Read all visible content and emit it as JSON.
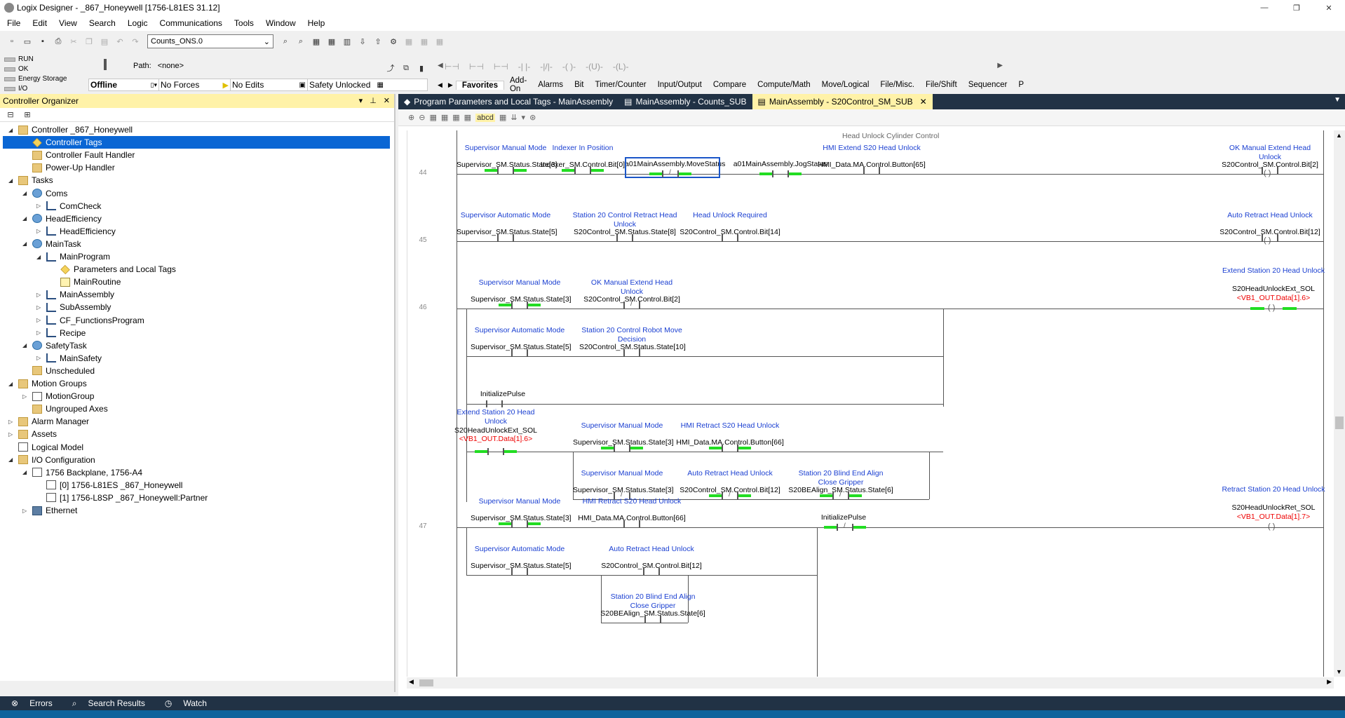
{
  "window": {
    "title": "Logix Designer - _867_Honeywell [1756-L81ES 31.12]"
  },
  "menu": [
    "File",
    "Edit",
    "View",
    "Search",
    "Logic",
    "Communications",
    "Tools",
    "Window",
    "Help"
  ],
  "toolbar": {
    "combo_value": "Counts_ONS.0"
  },
  "status": {
    "leds": [
      "RUN",
      "OK",
      "Energy Storage",
      "I/O"
    ],
    "path_label": "Path:",
    "path_value": "<none>",
    "mode": "Offline",
    "forces": "No Forces",
    "edits": "No Edits",
    "safety": "Safety Unlocked"
  },
  "instruction_tabs": [
    "Favorites",
    "Add-On",
    "Alarms",
    "Bit",
    "Timer/Counter",
    "Input/Output",
    "Compare",
    "Compute/Math",
    "Move/Logical",
    "File/Misc.",
    "File/Shift",
    "Sequencer",
    "P"
  ],
  "organizer": {
    "title": "Controller Organizer",
    "tree": [
      {
        "label": "Controller _867_Honeywell",
        "level": 0,
        "icon": "folder",
        "exp": "▲"
      },
      {
        "label": "Controller Tags",
        "level": 1,
        "icon": "tag",
        "exp": "",
        "selected": true
      },
      {
        "label": "Controller Fault Handler",
        "level": 1,
        "icon": "folder",
        "exp": ""
      },
      {
        "label": "Power-Up Handler",
        "level": 1,
        "icon": "folder",
        "exp": ""
      },
      {
        "label": "Tasks",
        "level": 0,
        "icon": "folder",
        "exp": "▲"
      },
      {
        "label": "Coms",
        "level": 1,
        "icon": "clock",
        "exp": "▲"
      },
      {
        "label": "ComCheck",
        "level": 2,
        "icon": "program",
        "exp": "▶"
      },
      {
        "label": "HeadEfficiency",
        "level": 1,
        "icon": "clock",
        "exp": "▲"
      },
      {
        "label": "HeadEfficiency",
        "level": 2,
        "icon": "program",
        "exp": "▶"
      },
      {
        "label": "MainTask",
        "level": 1,
        "icon": "clock",
        "exp": "▲"
      },
      {
        "label": "MainProgram",
        "level": 2,
        "icon": "program",
        "exp": "▲"
      },
      {
        "label": "Parameters and Local Tags",
        "level": 3,
        "icon": "tag",
        "exp": ""
      },
      {
        "label": "MainRoutine",
        "level": 3,
        "icon": "routine",
        "exp": ""
      },
      {
        "label": "MainAssembly",
        "level": 2,
        "icon": "program",
        "exp": "▶"
      },
      {
        "label": "SubAssembly",
        "level": 2,
        "icon": "program",
        "exp": "▶"
      },
      {
        "label": "CF_FunctionsProgram",
        "level": 2,
        "icon": "program",
        "exp": "▶"
      },
      {
        "label": "Recipe",
        "level": 2,
        "icon": "program",
        "exp": "▶"
      },
      {
        "label": "SafetyTask",
        "level": 1,
        "icon": "clock",
        "exp": "▲"
      },
      {
        "label": "MainSafety",
        "level": 2,
        "icon": "program",
        "exp": "▶"
      },
      {
        "label": "Unscheduled",
        "level": 1,
        "icon": "folder",
        "exp": ""
      },
      {
        "label": "Motion Groups",
        "level": 0,
        "icon": "folder",
        "exp": "▲"
      },
      {
        "label": "MotionGroup",
        "level": 1,
        "icon": "module",
        "exp": "▶"
      },
      {
        "label": "Ungrouped Axes",
        "level": 1,
        "icon": "folder",
        "exp": ""
      },
      {
        "label": "Alarm Manager",
        "level": 0,
        "icon": "folder",
        "exp": "▶"
      },
      {
        "label": "Assets",
        "level": 0,
        "icon": "folder",
        "exp": "▶"
      },
      {
        "label": "Logical Model",
        "level": 0,
        "icon": "module",
        "exp": ""
      },
      {
        "label": "I/O Configuration",
        "level": 0,
        "icon": "folder",
        "exp": "▲"
      },
      {
        "label": "1756 Backplane, 1756-A4",
        "level": 1,
        "icon": "module",
        "exp": "▲"
      },
      {
        "label": "[0] 1756-L81ES _867_Honeywell",
        "level": 2,
        "icon": "module",
        "exp": ""
      },
      {
        "label": "[1] 1756-L8SP _867_Honeywell:Partner",
        "level": 2,
        "icon": "module",
        "exp": ""
      },
      {
        "label": "Ethernet",
        "level": 1,
        "icon": "network",
        "exp": "▶"
      }
    ]
  },
  "doc_tabs": [
    {
      "label": "Program Parameters and Local Tags - MainAssembly",
      "active": false
    },
    {
      "label": "MainAssembly - Counts_SUB",
      "active": false
    },
    {
      "label": "MainAssembly - S20Control_SM_SUB",
      "active": true
    }
  ],
  "bottom_tabs": [
    "Errors",
    "Search Results",
    "Watch"
  ],
  "ladder": {
    "rung_comment": "Head Unlock Cylinder Control",
    "rung_numbers": [
      "44",
      "45",
      "46",
      "47"
    ],
    "r44": {
      "d1": "Supervisor Manual Mode",
      "t1": "Supervisor_SM.Status.State[3]",
      "d2": "Indexer In Position",
      "t2": "Indexer_SM.Control.Bit[0]",
      "t3": "a01MainAssembly.MoveStatus",
      "t4": "a01MainAssembly.JogStatus",
      "d5": "HMI Extend S20 Head Unlock",
      "t5": "HMI_Data.MA.Control.Button[65]",
      "dc": "OK Manual Extend Head Unlock",
      "tc": "S20Control_SM.Control.Bit[2]"
    },
    "r45": {
      "d1": "Supervisor Automatic Mode",
      "t1": "Supervisor_SM.Status.State[5]",
      "d2": "Station 20 Control Retract Head Unlock",
      "t2": "S20Control_SM.Status.State[8]",
      "d3": "Head Unlock Required",
      "t3": "S20Control_SM.Control.Bit[14]",
      "dc": "Auto Retract Head Unlock",
      "tc": "S20Control_SM.Control.Bit[12]"
    },
    "r46": {
      "d1": "Supervisor Manual Mode",
      "t1": "Supervisor_SM.Status.State[3]",
      "d2": "OK Manual Extend Head Unlock",
      "t2": "S20Control_SM.Control.Bit[2]",
      "d3": "Supervisor Automatic Mode",
      "t3": "Supervisor_SM.Status.State[5]",
      "d4": "Station 20 Control Robot Move Decision",
      "t4": "S20Control_SM.Status.State[10]",
      "t5": "InitializePulse",
      "d6": "Extend Station 20 Head Unlock",
      "t6": "S20HeadUnlockExt_SOL",
      "a6": "<VB1_OUT.Data[1].6>",
      "d7": "Supervisor Manual Mode",
      "t7": "Supervisor_SM.Status.State[3]",
      "d8": "HMI Retract S20 Head Unlock",
      "t8": "HMI_Data.MA.Control.Button[66]",
      "d9": "Supervisor Manual Mode",
      "t9": "Supervisor_SM.Status.State[3]",
      "d10": "Auto Retract Head Unlock",
      "t10": "S20Control_SM.Control.Bit[12]",
      "d11": "Station 20 Blind End Align Close Gripper",
      "t11": "S20BEAlign_SM.Status.State[6]",
      "dc": "Extend Station 20 Head Unlock",
      "tc": "S20HeadUnlockExt_SOL",
      "ac": "<VB1_OUT.Data[1].6>"
    },
    "r47": {
      "d1": "Supervisor Manual Mode",
      "t1": "Supervisor_SM.Status.State[3]",
      "d2": "HMI Retract S20 Head Unlock",
      "t2": "HMI_Data.MA.Control.Button[66]",
      "t3": "InitializePulse",
      "d4": "Supervisor Automatic Mode",
      "t4": "Supervisor_SM.Status.State[5]",
      "d5": "Auto Retract Head Unlock",
      "t5": "S20Control_SM.Control.Bit[12]",
      "d6": "Station 20 Blind End Align Close Gripper",
      "t6": "S20BEAlign_SM.Status.State[6]",
      "dc": "Retract Station 20 Head Unlock",
      "tc": "S20HeadUnlockRet_SOL",
      "ac": "<VB1_OUT.Data[1].7>"
    }
  },
  "colors": {
    "accent_yellow": "#fff2a8",
    "powered_green": "#22dd22",
    "selection_blue": "#0a66d4",
    "dark_chrome": "#213245"
  }
}
